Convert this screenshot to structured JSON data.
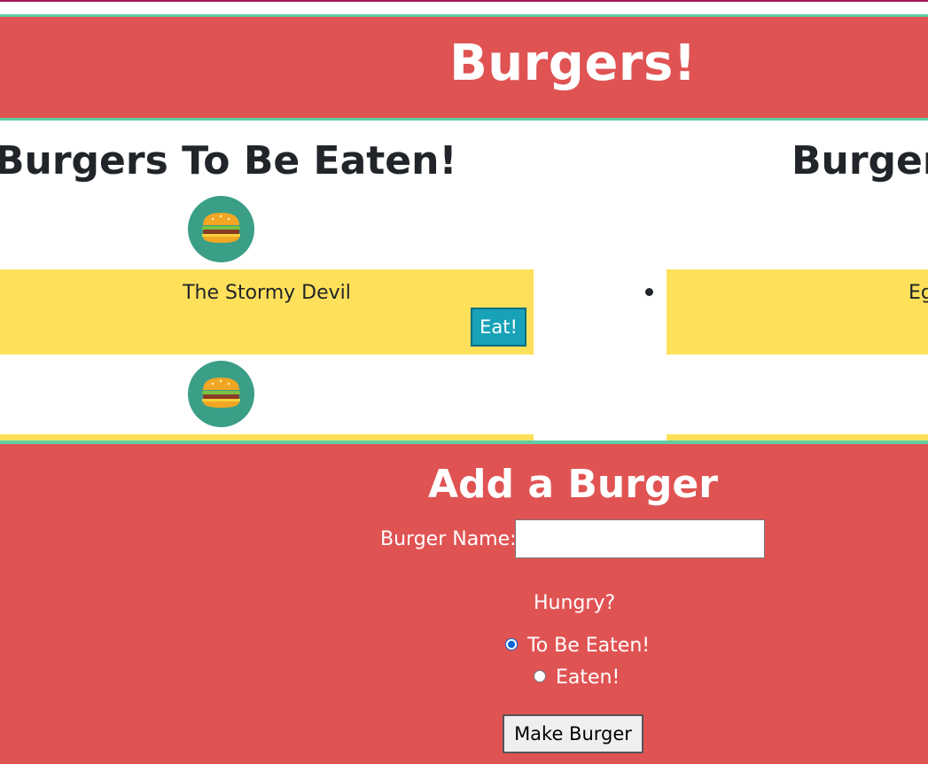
{
  "header": {
    "title": "Burgers!"
  },
  "columns": {
    "to_eat_title": "Burgers To Be Eaten!",
    "eaten_title": "Burgers"
  },
  "to_eat": [
    {
      "name": "The Stormy Devil",
      "button": "Eat!"
    }
  ],
  "eaten": [
    {
      "name": "Eg"
    }
  ],
  "form": {
    "title": "Add a Burger",
    "name_label": "Burger Name:",
    "name_value": "",
    "question": "Hungry?",
    "options": [
      {
        "label": "To Be Eaten!",
        "checked": true
      },
      {
        "label": "Eaten!",
        "checked": false
      }
    ],
    "submit": "Make Burger"
  },
  "icons": {
    "burger": "burger-icon"
  },
  "colors": {
    "header_bg": "#e05353",
    "accent_line": "#5fd0a6",
    "card_bg": "#ffe05a",
    "icon_circle": "#3b9e86",
    "eat_button": "#17a2b8"
  }
}
